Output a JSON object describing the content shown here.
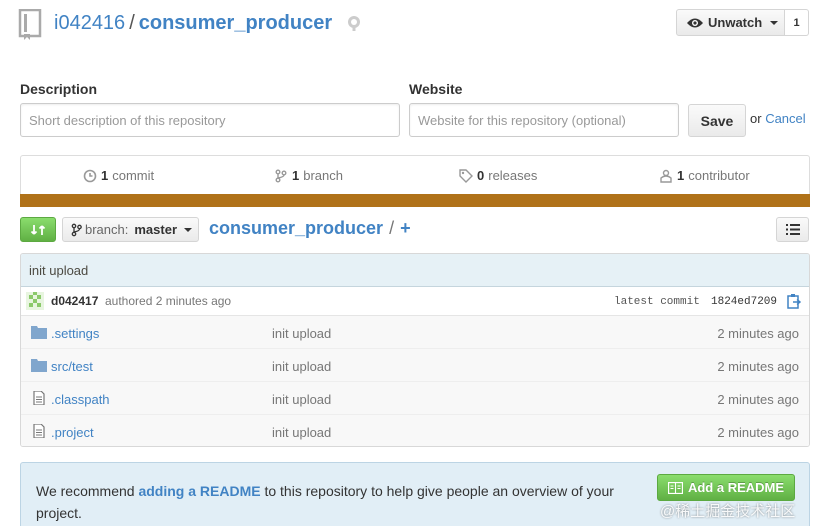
{
  "header": {
    "owner": "i042416",
    "separator": "/",
    "repo": "consumer_producer",
    "watch_label": "Unwatch",
    "watch_count": "1"
  },
  "edit_form": {
    "description_label": "Description",
    "description_placeholder": "Short description of this repository",
    "website_label": "Website",
    "website_placeholder": "Website for this repository (optional)",
    "save_label": "Save",
    "or_text": "or",
    "cancel_label": "Cancel"
  },
  "summary": {
    "commits": {
      "count": "1",
      "label": "commit"
    },
    "branches": {
      "count": "1",
      "label": "branch"
    },
    "releases": {
      "count": "0",
      "label": "releases"
    },
    "contributors": {
      "count": "1",
      "label": "contributor"
    },
    "language_color": "#b07219"
  },
  "file_nav": {
    "branch_label": "branch:",
    "branch_name": "master",
    "breadcrumb_repo": "consumer_producer",
    "breadcrumb_sep": "/",
    "breadcrumb_plus": "+"
  },
  "commit": {
    "message": "init upload",
    "author": "d042417",
    "authored_text": "authored 2 minutes ago",
    "latest_label": "latest commit",
    "sha": "1824ed7209"
  },
  "files": [
    {
      "type": "folder",
      "name": ".settings",
      "message": "init upload",
      "age": "2 minutes ago"
    },
    {
      "type": "folder",
      "name": "src/test",
      "message": "init upload",
      "age": "2 minutes ago"
    },
    {
      "type": "file",
      "name": ".classpath",
      "message": "init upload",
      "age": "2 minutes ago"
    },
    {
      "type": "file",
      "name": ".project",
      "message": "init upload",
      "age": "2 minutes ago"
    }
  ],
  "readme": {
    "text_before": "We recommend ",
    "link_text": "adding a README",
    "text_after": " to this repository to help give people an overview of your project.",
    "button_label": "Add a README"
  },
  "watermark": "@稀土掘金技术社区",
  "colors": {
    "link": "#4183c4",
    "green": "#60b044",
    "banner": "#e1eef6"
  }
}
